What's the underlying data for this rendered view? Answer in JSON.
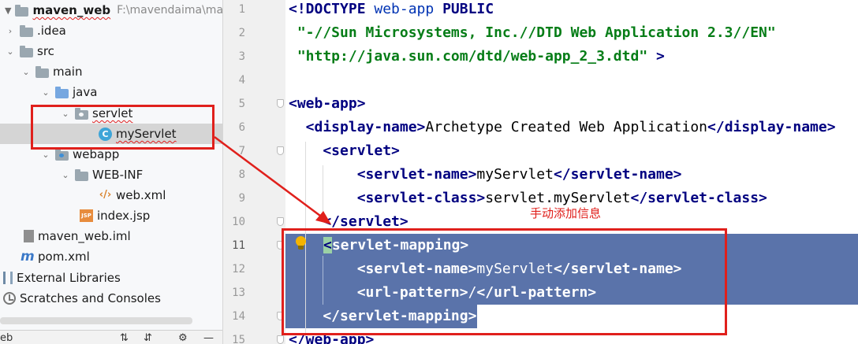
{
  "project_tree": {
    "items": [
      {
        "label": "maven_web",
        "path": "F:\\mavendaima\\maven",
        "icon": "folder-icon",
        "expanded": true
      },
      {
        "label": ".idea",
        "icon": "folder-icon",
        "expanded": false
      },
      {
        "label": "src",
        "icon": "folder-icon",
        "expanded": true
      },
      {
        "label": "main",
        "icon": "folder-icon",
        "expanded": true
      },
      {
        "label": "java",
        "icon": "source-folder-icon",
        "expanded": true
      },
      {
        "label": "servlet",
        "icon": "package-icon",
        "expanded": true
      },
      {
        "label": "myServlet",
        "icon": "class-icon",
        "selected": true
      },
      {
        "label": "webapp",
        "icon": "web-folder-icon",
        "expanded": true
      },
      {
        "label": "WEB-INF",
        "icon": "folder-icon",
        "expanded": true
      },
      {
        "label": "web.xml",
        "icon": "xml-file-icon"
      },
      {
        "label": "index.jsp",
        "icon": "jsp-file-icon"
      },
      {
        "label": "maven_web.iml",
        "icon": "iml-file-icon"
      },
      {
        "label": "pom.xml",
        "icon": "maven-file-icon"
      },
      {
        "label": "External Libraries",
        "icon": "library-icon",
        "expanded": false
      },
      {
        "label": "Scratches and Consoles",
        "icon": "scratches-icon",
        "expanded": false
      }
    ],
    "bottom_label": "eb"
  },
  "editor": {
    "line_numbers": [
      "1",
      "2",
      "3",
      "4",
      "5",
      "6",
      "7",
      "8",
      "9",
      "10",
      "11",
      "12",
      "13",
      "14",
      "15"
    ],
    "lines": {
      "l1_a": "<!DOCTYPE ",
      "l1_b": "web-app",
      "l1_c": " PUBLIC",
      "l2": " \"-//Sun Microsystems, Inc.//DTD Web Application 2.3//EN\"",
      "l3_a": " \"http://java.sun.com/dtd/web-app_2_3.dtd\"",
      "l3_b": " >",
      "l5": "<web-app>",
      "l6_a": "  <display-name>",
      "l6_b": "Archetype Created Web Application",
      "l6_c": "</display-name>",
      "l7": "    <servlet>",
      "l8_a": "        <servlet-name>",
      "l8_b": "myServlet",
      "l8_c": "</servlet-name>",
      "l9_a": "        <servlet-class>",
      "l9_b": "servlet.myServlet",
      "l9_c": "</servlet-class>",
      "l10": "    </servlet>",
      "l11_a": "<",
      "l11_b": "servlet-mapping>",
      "l12_a": "        <servlet-name>",
      "l12_b": "myServlet",
      "l12_c": "</servlet-name>",
      "l13_a": "        <url-pattern>",
      "l13_b": "/",
      "l13_c": "</url-pattern>",
      "l14": "    </servlet-mapping>",
      "l15": "</web-app>"
    }
  },
  "annotation": {
    "note": "手动添加信息",
    "color": "#e0201c"
  },
  "colors": {
    "selection": "#5a73aa",
    "tag": "#000080",
    "string": "#067d17"
  }
}
